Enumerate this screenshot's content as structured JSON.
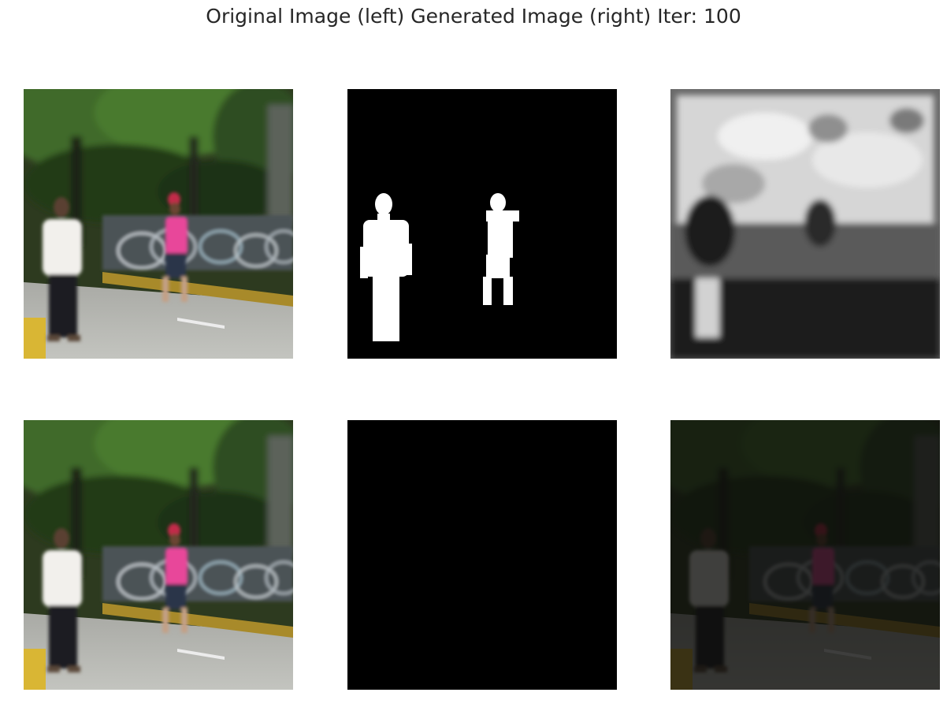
{
  "title": "Original Image (left) Generated Image (right) Iter: 100",
  "panels": [
    {
      "row": 1,
      "col": 1,
      "content": "original-photo"
    },
    {
      "row": 1,
      "col": 2,
      "content": "segmentation-mask"
    },
    {
      "row": 1,
      "col": 3,
      "content": "generated-grayscale"
    },
    {
      "row": 2,
      "col": 1,
      "content": "original-photo"
    },
    {
      "row": 2,
      "col": 2,
      "content": "masked-people-cutout"
    },
    {
      "row": 2,
      "col": 3,
      "content": "generated-dark-image"
    }
  ],
  "colors": {
    "background": "#ffffff",
    "title_text": "#262626",
    "mask_background": "#000000",
    "mask_foreground": "#ffffff",
    "shirt_pink": "#e8479a"
  }
}
